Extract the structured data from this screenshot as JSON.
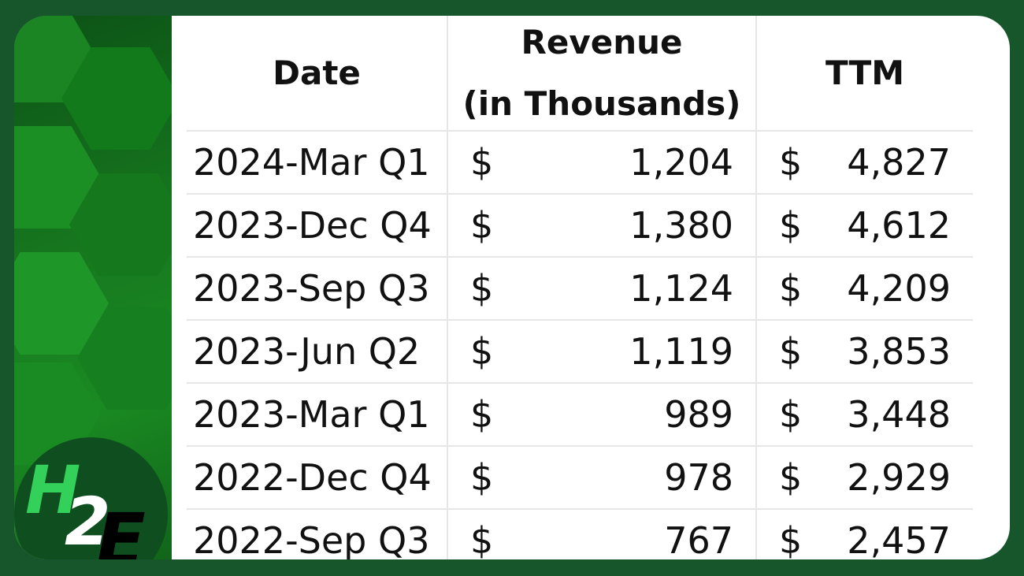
{
  "logo": {
    "h": "H",
    "two": "2",
    "e": "E"
  },
  "columns": {
    "date": "Date",
    "revenue_line1": "Revenue",
    "revenue_line2": "(in Thousands)",
    "ttm": "TTM"
  },
  "currency_symbol": "$",
  "rows": [
    {
      "date": "2024-Mar Q1",
      "revenue": "1,204",
      "ttm": "4,827"
    },
    {
      "date": "2023-Dec Q4",
      "revenue": "1,380",
      "ttm": "4,612"
    },
    {
      "date": "2023-Sep Q3",
      "revenue": "1,124",
      "ttm": "4,209"
    },
    {
      "date": "2023-Jun Q2",
      "revenue": "1,119",
      "ttm": "3,853"
    },
    {
      "date": "2023-Mar Q1",
      "revenue": "989",
      "ttm": "3,448"
    },
    {
      "date": "2022-Dec Q4",
      "revenue": "978",
      "ttm": "2,929"
    },
    {
      "date": "2022-Sep Q3",
      "revenue": "767",
      "ttm": "2,457"
    }
  ]
}
